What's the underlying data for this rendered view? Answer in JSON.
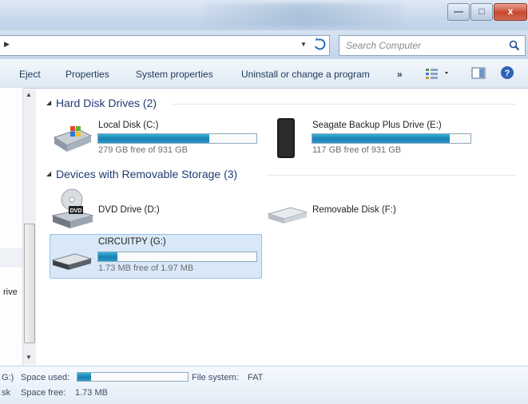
{
  "window": {
    "minimize_glyph": "—",
    "maximize_glyph": "□",
    "close_glyph": "x"
  },
  "address": {
    "search_placeholder": "Search Computer"
  },
  "toolbar": {
    "eject": "Eject",
    "properties": "Properties",
    "system_properties": "System properties",
    "uninstall": "Uninstall or change a program",
    "overflow": "»"
  },
  "groups": {
    "hard_disks": "Hard Disk Drives (2)",
    "removable": "Devices with Removable Storage (3)"
  },
  "drives": {
    "c": {
      "name": "Local Disk (C:)",
      "free": "279 GB free of 931 GB",
      "used_fraction": 0.7
    },
    "e": {
      "name": "Seagate Backup Plus Drive (E:)",
      "free": "117 GB free of 931 GB",
      "used_fraction": 0.87
    },
    "d": {
      "name": "DVD Drive (D:)"
    },
    "f": {
      "name": "Removable Disk (F:)"
    },
    "g": {
      "name": "CIRCUITPY (G:)",
      "free": "1.73 MB free of 1.97 MB",
      "used_fraction": 0.12
    }
  },
  "sidebar": {
    "partial_label": "rive"
  },
  "details": {
    "left_top": "G:)",
    "left_bottom": "sk",
    "space_used_label": "Space used:",
    "space_used_fraction": 0.12,
    "filesystem_label": "File system:",
    "filesystem": "FAT",
    "space_free_label": "Space free:",
    "space_free": "1.73 MB"
  },
  "colors": {
    "bar_fill": "#1a7fb3",
    "selection": "#d8e8f8",
    "group_heading": "#1f3b72"
  }
}
